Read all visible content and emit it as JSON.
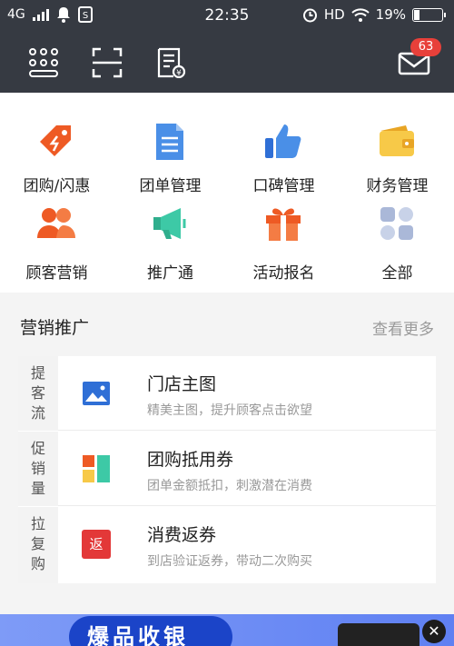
{
  "status_bar": {
    "network": "4G",
    "time": "22:35",
    "hd_label": "HD",
    "battery": "19%"
  },
  "toolbar": {
    "message_count": "63"
  },
  "grid": [
    {
      "label": "团购/闪惠"
    },
    {
      "label": "团单管理"
    },
    {
      "label": "口碑管理"
    },
    {
      "label": "财务管理"
    },
    {
      "label": "顾客营销"
    },
    {
      "label": "推广通"
    },
    {
      "label": "活动报名"
    },
    {
      "label": "全部"
    }
  ],
  "section": {
    "title": "营销推广",
    "more": "查看更多"
  },
  "promo": {
    "tags": [
      {
        "text": "提客流"
      },
      {
        "text": "促销量"
      },
      {
        "text": "拉复购"
      }
    ],
    "items": [
      {
        "title": "门店主图",
        "subtitle": "精美主图，提升顾客点击欲望"
      },
      {
        "title": "团购抵用券",
        "subtitle": "团单金额抵扣，刺激潜在消费"
      },
      {
        "title": "消费返券",
        "subtitle": "到店验证返券，带动二次购买",
        "icon_text": "返"
      }
    ]
  },
  "banner": {
    "text": "爆品收银",
    "close": "✕"
  },
  "colors": {
    "header_bg": "#363a42",
    "badge": "#e8403a",
    "orange": "#ee5a24",
    "blue": "#4a8fe7",
    "green": "#3dc9a6",
    "yellow": "#f7c948"
  }
}
